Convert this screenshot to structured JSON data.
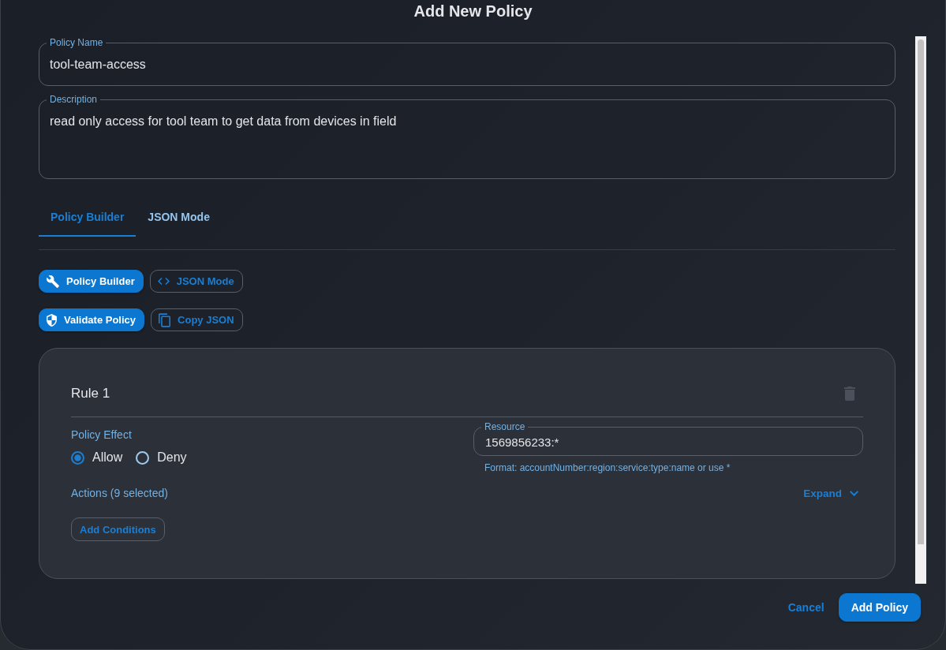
{
  "dialog": {
    "title": "Add New Policy"
  },
  "fields": [
    {
      "kind": "single_line",
      "label": "Policy Name",
      "value": "tool-team-access"
    },
    {
      "kind": "multi_line",
      "label": "Description",
      "value": "read only access for tool team to get data from devices in field"
    }
  ],
  "tabs": [
    {
      "label": "Policy Builder",
      "selected": true
    },
    {
      "label": "JSON Mode",
      "selected": false
    }
  ],
  "mode_buttons": [
    {
      "label": "Policy Builder",
      "selected": true
    },
    {
      "label": "JSON Mode",
      "selected": false
    }
  ],
  "action_buttons": [
    {
      "label": "Validate Policy",
      "kind": "contained"
    },
    {
      "label": "Copy JSON",
      "kind": "outlined"
    }
  ],
  "rules": [
    {
      "title": "Rule 1",
      "delete_button": {
        "disabled": true
      },
      "effect": {
        "label": "Policy Effect",
        "options": [
          {
            "label": "Allow",
            "selected": true
          },
          {
            "label": "Deny",
            "selected": false
          }
        ]
      },
      "resource": {
        "label": "Resource",
        "value": "1569856233:*",
        "helper": "Format: accountNumber:region:service:type:name or use *"
      },
      "actions": {
        "label": "Actions (9 selected)",
        "toggle_label": "Expand",
        "expanded": false
      },
      "add_conditions_button": {
        "label": "Add Conditions"
      }
    }
  ],
  "footer": {
    "buttons": [
      {
        "label": "Cancel",
        "kind": "text"
      },
      {
        "label": "Add Policy",
        "kind": "contained"
      }
    ]
  }
}
